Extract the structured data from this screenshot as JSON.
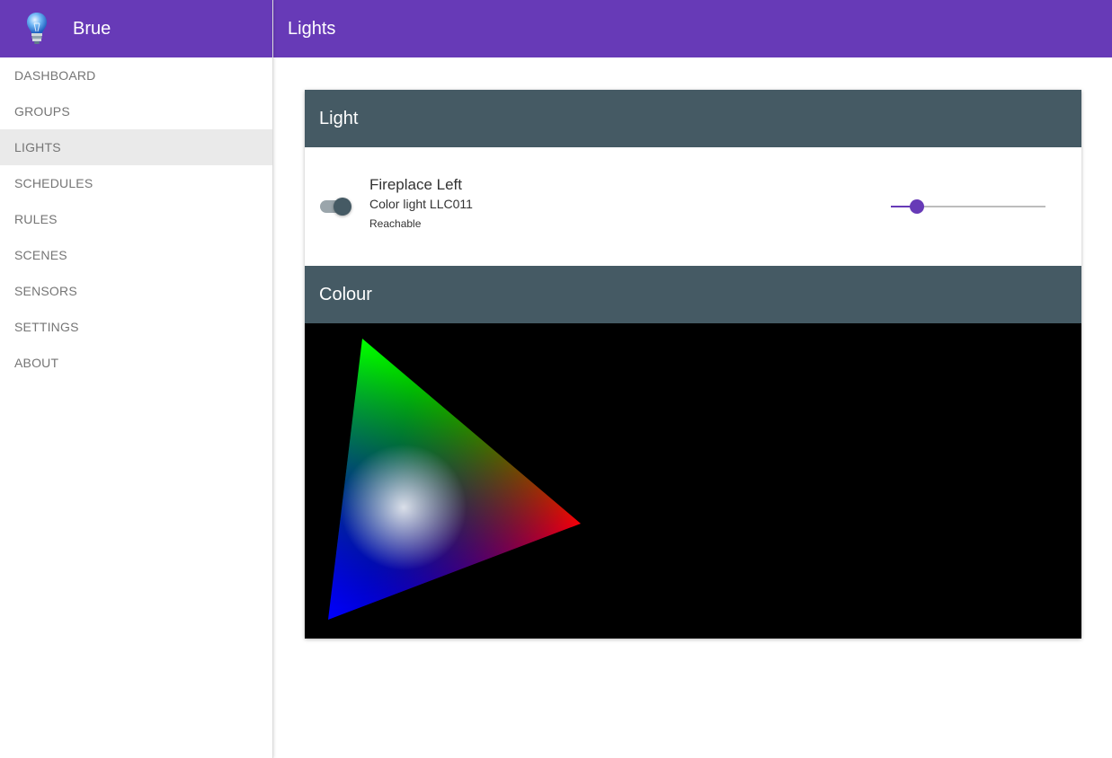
{
  "app": {
    "name": "Brue",
    "logo_icon": "lightbulb-icon"
  },
  "nav": {
    "items": [
      {
        "label": "DASHBOARD",
        "active": false
      },
      {
        "label": "GROUPS",
        "active": false
      },
      {
        "label": "LIGHTS",
        "active": true
      },
      {
        "label": "SCHEDULES",
        "active": false
      },
      {
        "label": "RULES",
        "active": false
      },
      {
        "label": "SCENES",
        "active": false
      },
      {
        "label": "SENSORS",
        "active": false
      },
      {
        "label": "SETTINGS",
        "active": false
      },
      {
        "label": "ABOUT",
        "active": false
      }
    ]
  },
  "header": {
    "title": "Lights"
  },
  "light_section": {
    "title": "Light",
    "light": {
      "name": "Fireplace Left",
      "model": "Color light LLC011",
      "status": "Reachable",
      "on": true,
      "brightness": 0.17
    }
  },
  "colour_section": {
    "title": "Colour"
  },
  "colors": {
    "primary": "#673ab7",
    "section_header": "#455a64",
    "toggle_on": "#455a64",
    "colour_background": "#000000"
  }
}
